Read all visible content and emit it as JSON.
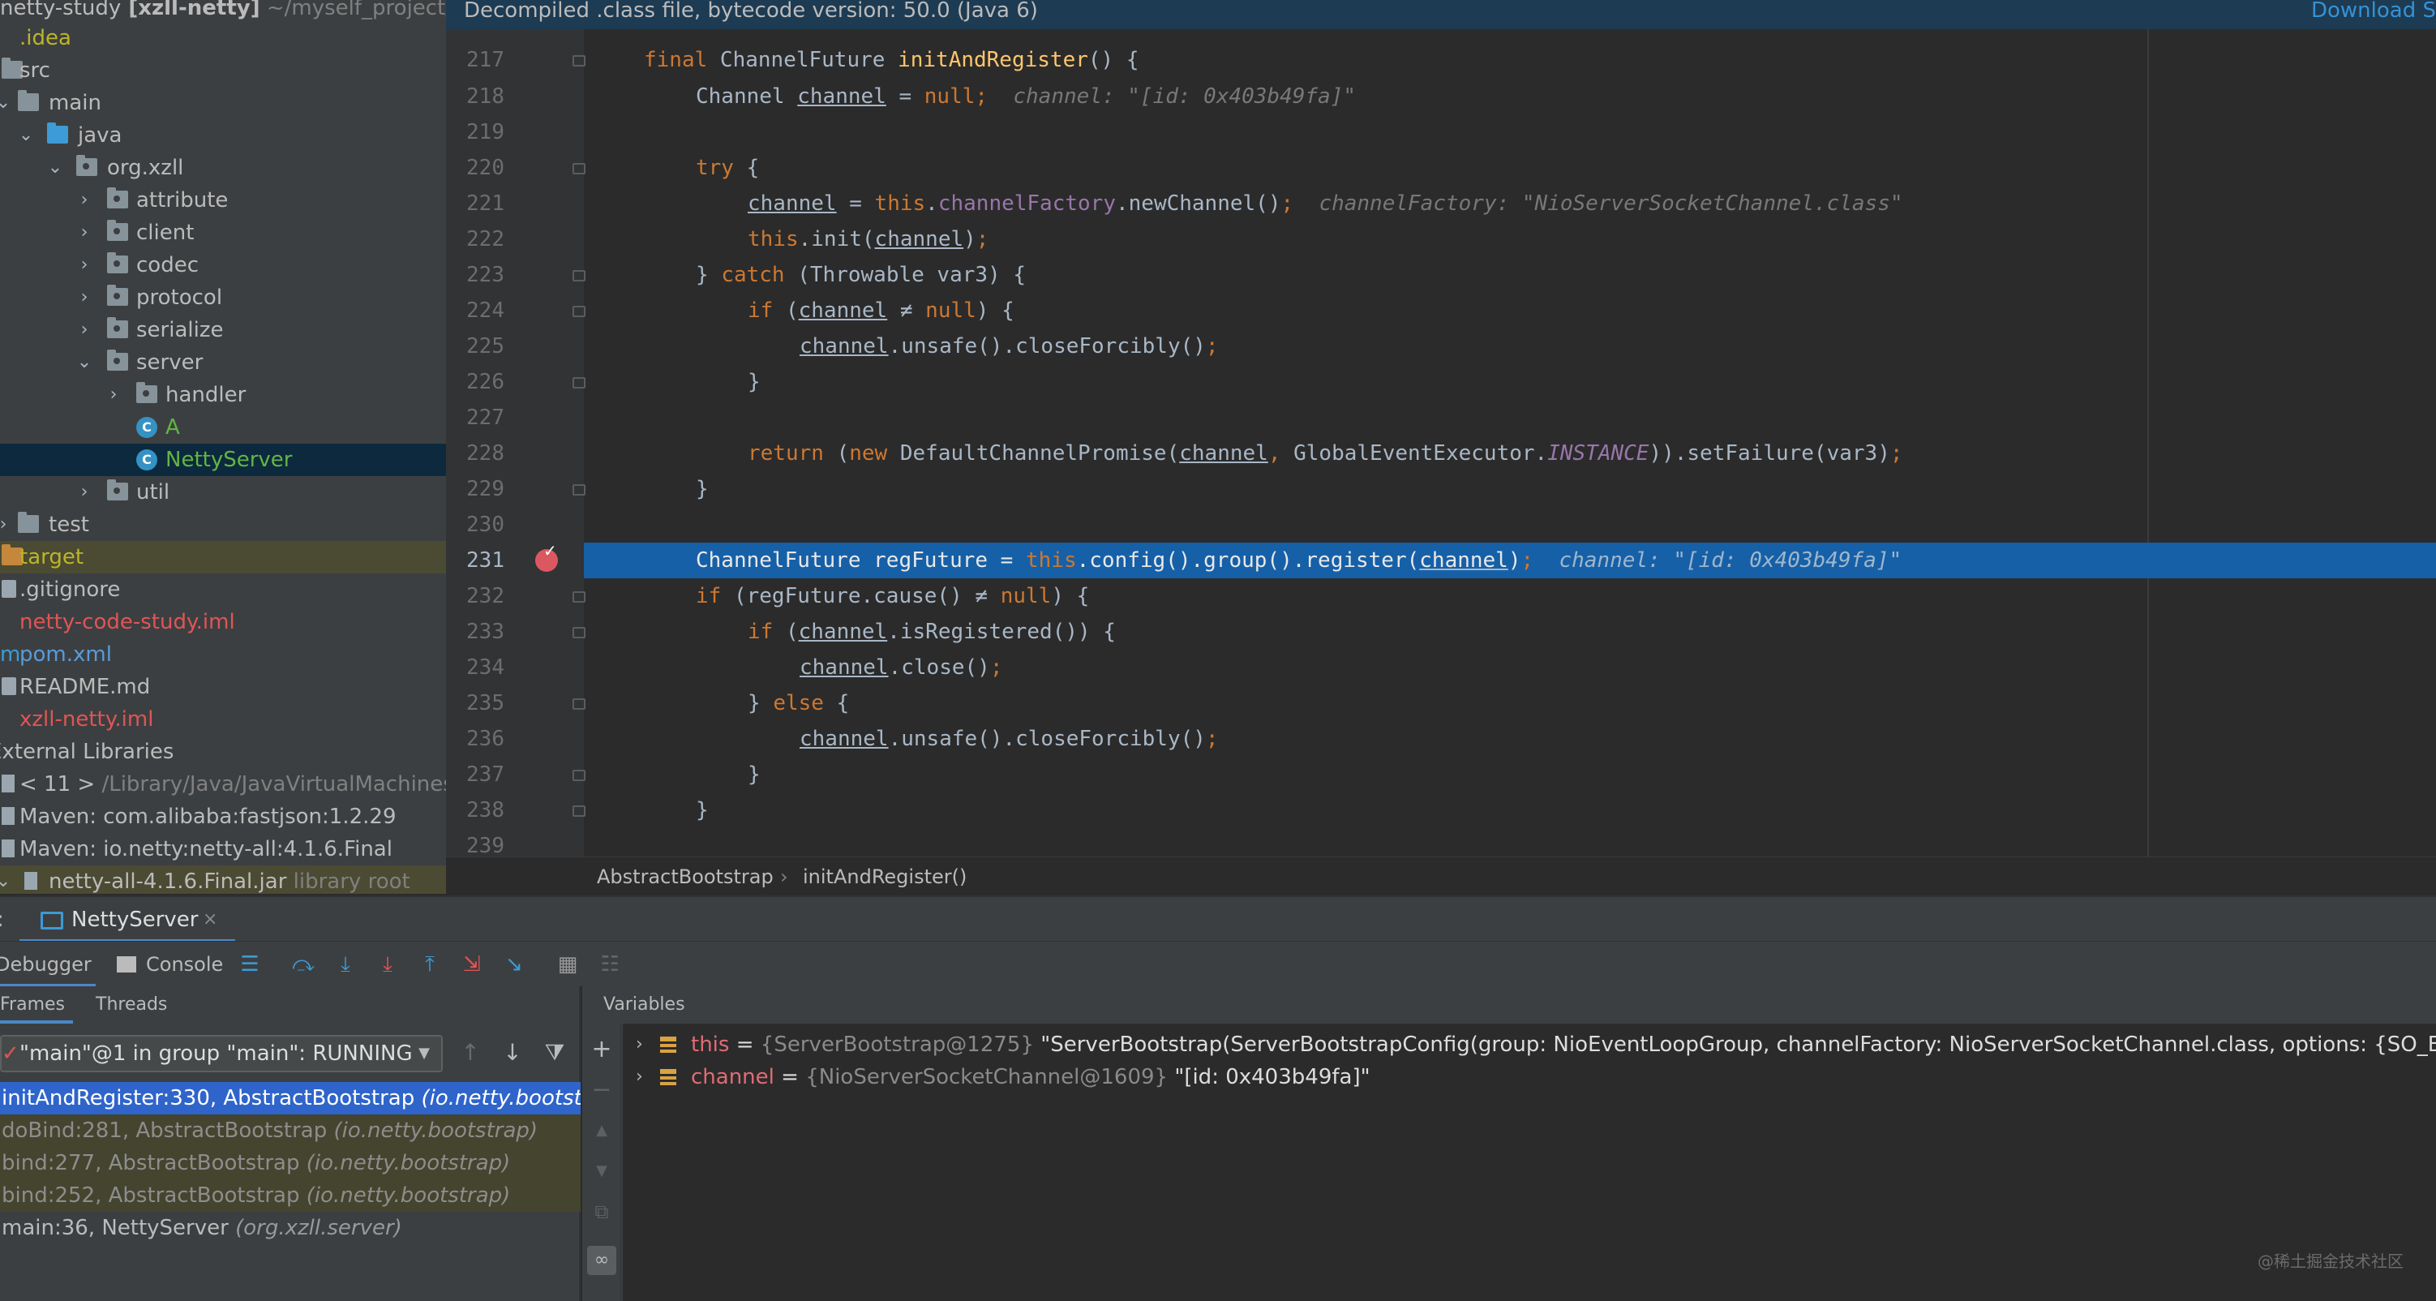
{
  "project_tree": {
    "rows": [
      {
        "label": "netty-study",
        "bold_suffix": " [xzll-netty]",
        "hint": " ~/myself_project/im",
        "kind": "root"
      },
      {
        "label": ".idea",
        "kind": "folder-orange",
        "color": "yellowish"
      },
      {
        "label": "src",
        "kind": "folder"
      },
      {
        "label": "main",
        "kind": "folder"
      },
      {
        "label": "java",
        "kind": "folder-blue"
      },
      {
        "label": "org.xzll",
        "kind": "package"
      },
      {
        "label": "attribute",
        "kind": "package"
      },
      {
        "label": "client",
        "kind": "package"
      },
      {
        "label": "codec",
        "kind": "package"
      },
      {
        "label": "protocol",
        "kind": "package"
      },
      {
        "label": "serialize",
        "kind": "package"
      },
      {
        "label": "server",
        "kind": "package"
      },
      {
        "label": "handler",
        "kind": "package"
      },
      {
        "label": "A",
        "kind": "class"
      },
      {
        "label": "NettyServer",
        "kind": "class"
      },
      {
        "label": "util",
        "kind": "package"
      },
      {
        "label": "test",
        "kind": "folder"
      },
      {
        "label": "target",
        "kind": "folder-orange"
      },
      {
        "label": ".gitignore",
        "kind": "file"
      },
      {
        "label": "netty-code-study.iml",
        "kind": "file"
      },
      {
        "label": "pom.xml",
        "kind": "file"
      },
      {
        "label": "README.md",
        "kind": "file"
      },
      {
        "label": "xzll-netty.iml",
        "kind": "file"
      },
      {
        "label": "External Libraries",
        "kind": "section"
      },
      {
        "label": "< 11 >",
        "hint": " /Library/Java/JavaVirtualMachines/o",
        "kind": "lib"
      },
      {
        "label": "Maven: com.alibaba:fastjson:1.2.29",
        "kind": "lib"
      },
      {
        "label": "Maven: io.netty:netty-all:4.1.6.Final",
        "kind": "lib"
      },
      {
        "label": "netty-all-4.1.6.Final.jar",
        "hint": " library root",
        "kind": "jar"
      }
    ]
  },
  "editor": {
    "banner": "Decompiled .class file, bytecode version: 50.0 (Java 6)",
    "banner_link": "Download S",
    "breadcrumb": [
      "AbstractBootstrap",
      "initAndRegister()"
    ],
    "breadcrumb_sep": "›",
    "line_numbers": [
      "217",
      "218",
      "219",
      "220",
      "221",
      "222",
      "223",
      "224",
      "225",
      "226",
      "227",
      "228",
      "229",
      "230",
      "231",
      "232",
      "233",
      "234",
      "235",
      "236",
      "237",
      "238",
      "239"
    ],
    "code": {
      "l217_final": "final ",
      "l217_type": "ChannelFuture ",
      "l217_name": "initAndRegister",
      "l217_rest": "() {",
      "l218_type": "Channel ",
      "l218_var": "channel",
      "l218_eq": " = ",
      "l218_null": "null",
      "l218_semi": ";",
      "l218_hint": "  channel: \"[id: 0x403b49fa]\"",
      "l220_try": "try",
      "l220_rest": " {",
      "l221_var": "channel",
      "l221_eq": " = ",
      "l221_this": "this",
      "l221_dot": ".",
      "l221_field": "channelFactory",
      "l221_call": ".newChannel()",
      "l221_semi": ";",
      "l221_hint": "  channelFactory: \"NioServerSocketChannel.class\"",
      "l222_this": "this",
      "l222_call": ".init(",
      "l222_var": "channel",
      "l222_close": ")",
      "l222_semi": ";",
      "l223_brace": "} ",
      "l223_catch": "catch",
      "l223_rest": " (Throwable var3) {",
      "l224_if": "if",
      "l224_open": " (",
      "l224_var": "channel",
      "l224_ne": " ≠ ",
      "l224_null": "null",
      "l224_rest": ") {",
      "l225_var": "channel",
      "l225_call": ".unsafe().closeForcibly()",
      "l225_semi": ";",
      "l226": "}",
      "l228_return": "return",
      "l228_open": " (",
      "l228_new": "new",
      "l228_cls": " DefaultChannelPromise(",
      "l228_var": "channel",
      "l228_comma": ", ",
      "l228_exec": "GlobalEventExecutor.",
      "l228_inst": "INSTANCE",
      "l228_rest": ")).setFailure(var3)",
      "l228_semi": ";",
      "l229": "}",
      "l231_decl": "ChannelFuture regFuture = ",
      "l231_this": "this",
      "l231_call": ".config().group().register(",
      "l231_var": "channel",
      "l231_close": ")",
      "l231_semi": ";",
      "l231_hint": "  channel: \"[id: 0x403b49fa]\"",
      "l232_if": "if",
      "l232_mid": " (regFuture.cause() ≠ ",
      "l232_null": "null",
      "l232_rest": ") {",
      "l233_if": "if",
      "l233_open": " (",
      "l233_var": "channel",
      "l233_rest": ".isRegistered()) {",
      "l234_var": "channel",
      "l234_call": ".close()",
      "l234_semi": ";",
      "l235_brace": "} ",
      "l235_else": "else",
      "l235_rest": " {",
      "l236_var": "channel",
      "l236_call": ".unsafe().closeForcibly()",
      "l236_semi": ";",
      "l237": "}",
      "l238": "}"
    }
  },
  "debug": {
    "run_config": "NettyServer",
    "close_glyph": "×",
    "tabs": {
      "debugger": "Debugger",
      "console": "Console"
    },
    "subtabs": {
      "frames": "Frames",
      "threads": "Threads",
      "variables": "Variables"
    },
    "thread": "\"main\"@1 in group \"main\": RUNNING",
    "frames": [
      {
        "method": "initAndRegister:330, AbstractBootstrap ",
        "pkg": "(io.netty.bootstrap)",
        "state": "selected"
      },
      {
        "method": "doBind:281, AbstractBootstrap ",
        "pkg": "(io.netty.bootstrap)",
        "state": "library"
      },
      {
        "method": "bind:277, AbstractBootstrap ",
        "pkg": "(io.netty.bootstrap)",
        "state": "library"
      },
      {
        "method": "bind:252, AbstractBootstrap ",
        "pkg": "(io.netty.bootstrap)",
        "state": "library"
      },
      {
        "method": "main:36, NettyServer ",
        "pkg": "(org.xzll.server)",
        "state": "normal"
      }
    ],
    "variables": [
      {
        "name": "this",
        "eq": " = ",
        "type": "{ServerBootstrap@1275} ",
        "value": "\"ServerBootstrap(ServerBootstrapConfig(group: NioEventLoopGroup, channelFactory: NioServerSocketChannel.class, options: {SO_BACKLOG"
      },
      {
        "name": "channel",
        "eq": " = ",
        "type": "{NioServerSocketChannel@1609} ",
        "value": "\"[id: 0x403b49fa]\""
      }
    ]
  },
  "watermark": "@稀土掘金技术社区"
}
